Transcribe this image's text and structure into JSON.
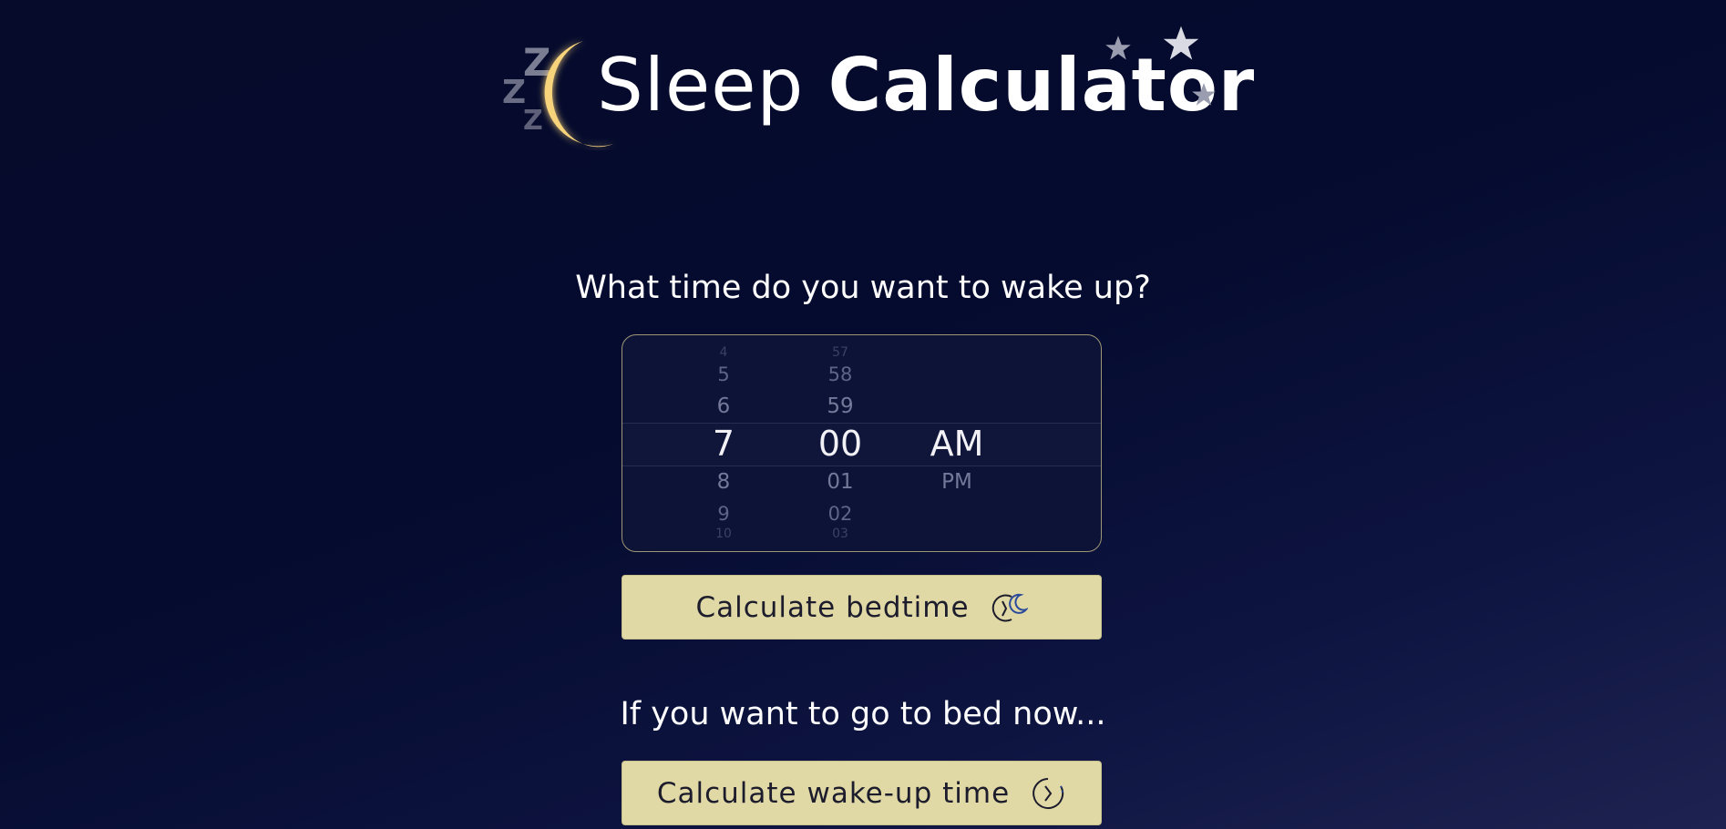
{
  "header": {
    "title_light": "Sleep",
    "title_bold": "Calculator",
    "logo_icons": [
      "zzz-icon",
      "moon-icon",
      "star-icon"
    ],
    "zzz": [
      "Z",
      "Z",
      "Z"
    ]
  },
  "colors": {
    "background": "#050b2e",
    "moon": "#f7d37c",
    "button": "#e0d9a6",
    "picker_border": "#9e9775",
    "text": "#ffffff"
  },
  "wake_section": {
    "question": "What time do you want to wake up?",
    "picker": {
      "hours": [
        "4",
        "5",
        "6",
        "7",
        "8",
        "9",
        "10"
      ],
      "minutes": [
        "57",
        "58",
        "59",
        "00",
        "01",
        "02",
        "03"
      ],
      "periods": [
        "AM",
        "PM"
      ],
      "selected_hour": "7",
      "selected_minute": "00",
      "selected_period": "AM"
    },
    "button_label": "Calculate bedtime",
    "button_icon": "clock-moon-icon"
  },
  "now_section": {
    "question": "If you want to go to bed now...",
    "button_label": "Calculate wake-up time",
    "button_icon": "clock-arrow-icon"
  }
}
